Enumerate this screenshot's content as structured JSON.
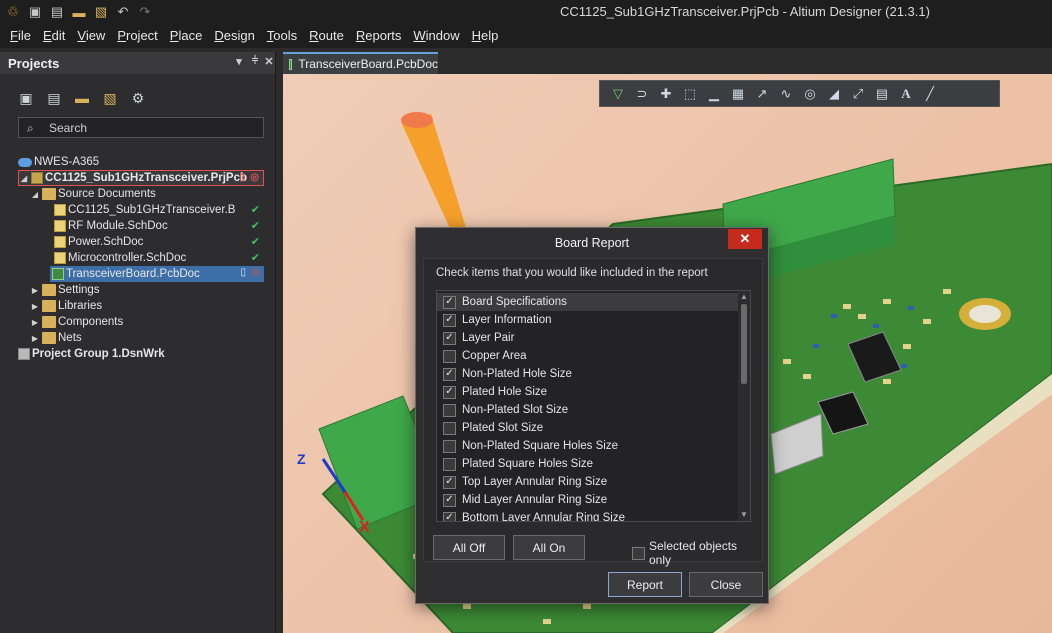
{
  "app": {
    "title": "CC1125_Sub1GHzTransceiver.PrjPcb - Altium Designer (21.3.1)",
    "quick_access": [
      "app-logo-icon",
      "save-icon",
      "save-all-icon",
      "open-folder-icon",
      "open-project-icon",
      "undo-icon",
      "redo-icon"
    ]
  },
  "menu": [
    "File",
    "Edit",
    "View",
    "Project",
    "Place",
    "Design",
    "Tools",
    "Route",
    "Reports",
    "Window",
    "Help"
  ],
  "projects_panel": {
    "title": "Projects",
    "search_placeholder": "Search",
    "tree": [
      {
        "label": "NWES-A365",
        "icon": "cloud-icon"
      },
      {
        "label": "CC1125_Sub1GHzTransceiver.PrjPcb",
        "icon": "project-icon"
      },
      {
        "label": "Source Documents",
        "icon": "folder-icon"
      },
      {
        "label": "CC1125_Sub1GHzTransceiver.B",
        "icon": "schdoc-icon"
      },
      {
        "label": "RF Module.SchDoc",
        "icon": "schdoc-icon"
      },
      {
        "label": "Power.SchDoc",
        "icon": "schdoc-icon"
      },
      {
        "label": "Microcontroller.SchDoc",
        "icon": "schdoc-icon"
      },
      {
        "label": "TransceiverBoard.PcbDoc",
        "icon": "pcbdoc-icon"
      },
      {
        "label": "Settings",
        "icon": "folder-icon"
      },
      {
        "label": "Libraries",
        "icon": "folder-icon"
      },
      {
        "label": "Components",
        "icon": "folder-icon"
      },
      {
        "label": "Nets",
        "icon": "folder-icon"
      },
      {
        "label": "Project Group 1.DsnWrk",
        "icon": "project-group-icon"
      }
    ]
  },
  "document_tab": {
    "label": "TransceiverBoard.PcbDoc"
  },
  "viewport": {
    "axis_labels": {
      "z": "Z",
      "x": "X"
    }
  },
  "dialog": {
    "title": "Board Report",
    "instruction": "Check items that you would like included in the report",
    "items": [
      {
        "label": "Board Specifications",
        "checked": true
      },
      {
        "label": "Layer Information",
        "checked": true
      },
      {
        "label": "Layer Pair",
        "checked": true
      },
      {
        "label": "Copper Area",
        "checked": false
      },
      {
        "label": "Non-Plated Hole Size",
        "checked": true
      },
      {
        "label": "Plated Hole Size",
        "checked": true
      },
      {
        "label": "Non-Plated Slot Size",
        "checked": false
      },
      {
        "label": "Plated Slot Size",
        "checked": false
      },
      {
        "label": "Non-Plated Square Holes Size",
        "checked": false
      },
      {
        "label": "Plated Square Holes Size",
        "checked": false
      },
      {
        "label": "Top Layer Annular Ring Size",
        "checked": true
      },
      {
        "label": "Mid Layer Annular Ring Size",
        "checked": true
      },
      {
        "label": "Bottom Layer Annular Ring Size",
        "checked": true
      }
    ],
    "all_off_label": "All Off",
    "all_on_label": "All On",
    "selected_only_label": "Selected objects only",
    "report_label": "Report",
    "close_label": "Close"
  },
  "colors": {
    "accent": "#6aa0d8",
    "ok_status": "#3ec65a",
    "error_status": "#e05050",
    "close_button": "#c42b1c",
    "pcb_green": "#3c8a36",
    "connector_green": "#3fa84a"
  }
}
